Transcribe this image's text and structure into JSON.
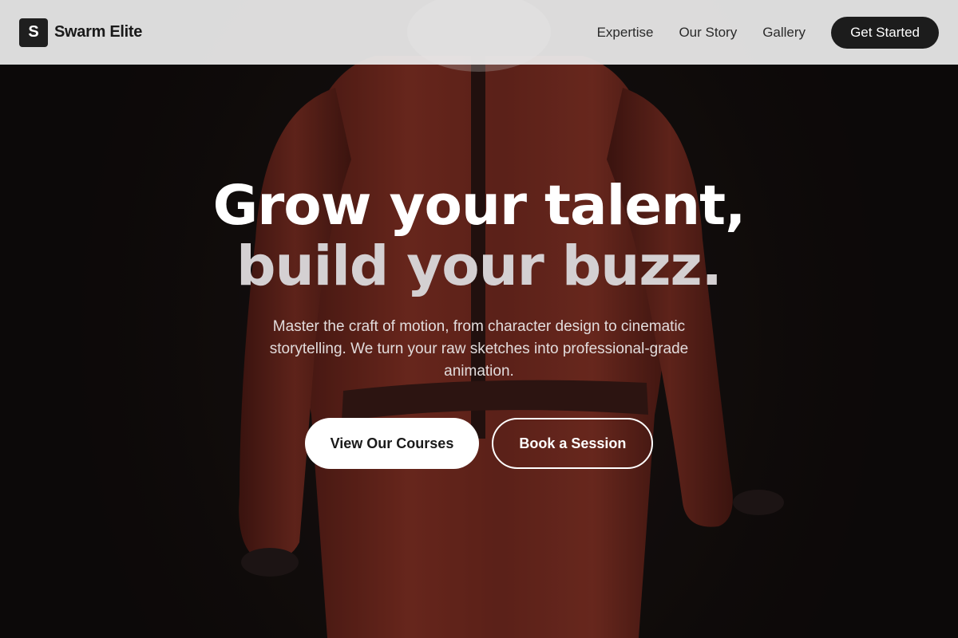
{
  "brand": {
    "logo_letter": "S",
    "name": "Swarm Elite"
  },
  "nav": {
    "links": [
      "Expertise",
      "Our Story",
      "Gallery"
    ],
    "cta_label": "Get Started"
  },
  "hero": {
    "headline_line1": "Grow your talent,",
    "headline_line2": "build your buzz.",
    "subtitle": "Master the craft of motion, from character design to cinematic storytelling. We turn your raw sketches into professional-grade animation.",
    "primary_button": "View Our Courses",
    "secondary_button": "Book a Session"
  },
  "colors": {
    "navbar_bg": "#ececec",
    "accent_dark": "#1c1c1c",
    "hero_bg": "#141010",
    "figure_red": "#7a2a20"
  }
}
